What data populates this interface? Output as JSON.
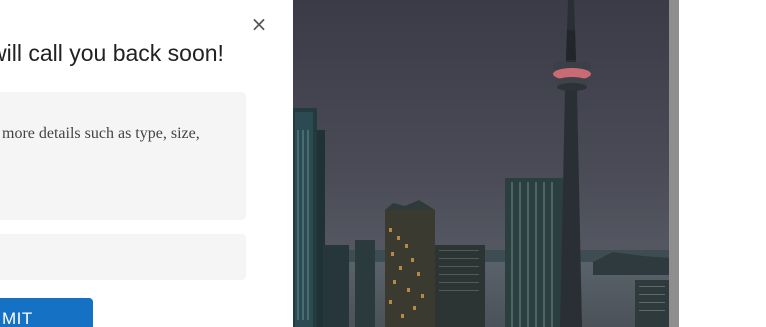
{
  "modal": {
    "title": "will call you back soon!",
    "close_icon": "close-icon",
    "close_glyph": "×",
    "message_placeholder": "more details such as type, size,",
    "submit_label": "MIT"
  },
  "colors": {
    "submit_bg": "#1571c3",
    "field_bg": "#f5f5f5",
    "title": "#222222"
  },
  "photo": {
    "subject": "city-skyline-photo"
  }
}
